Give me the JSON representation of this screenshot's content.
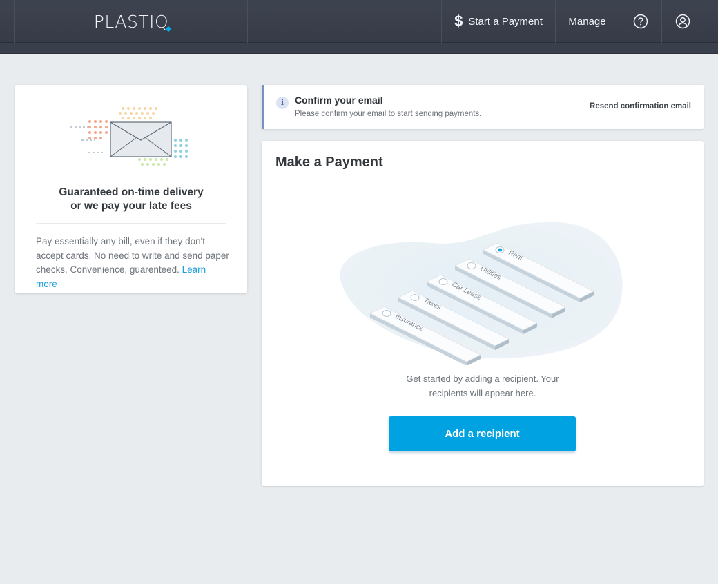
{
  "nav": {
    "logo_text": "PLASTI",
    "logo_q": "Q",
    "start_payment_icon": "dollar-icon",
    "start_payment_label": "Start a Payment",
    "manage_label": "Manage",
    "help_icon": "help-circle-icon",
    "account_icon": "user-circle-icon"
  },
  "promo": {
    "illustration_icon": "envelope-icon",
    "title": "Guaranteed on-time delivery\nor we pay your late fees",
    "body": "Pay essentially any bill, even if they don't accept cards. No need to write and send paper checks. Convenience, guarenteed. ",
    "link": "Learn more"
  },
  "alert": {
    "icon": "info-icon",
    "title": "Confirm your email",
    "subtitle": "Please confirm your email to start sending payments.",
    "action": "Resend confirmation email"
  },
  "payment": {
    "title": "Make a Payment",
    "categories": [
      "Rent",
      "Utilities",
      "Car Lease",
      "Taxes",
      "Insurance"
    ],
    "empty_text": "Get started by adding a recipient. Your\nrecipients will appear here.",
    "button_label": "Add a recipient"
  },
  "colors": {
    "nav_bg": "#3a3f4c",
    "page_bg": "#e8ecee",
    "accent": "#00a2e1",
    "link": "#1a9fd9",
    "alert_border": "#7a8fc4"
  }
}
